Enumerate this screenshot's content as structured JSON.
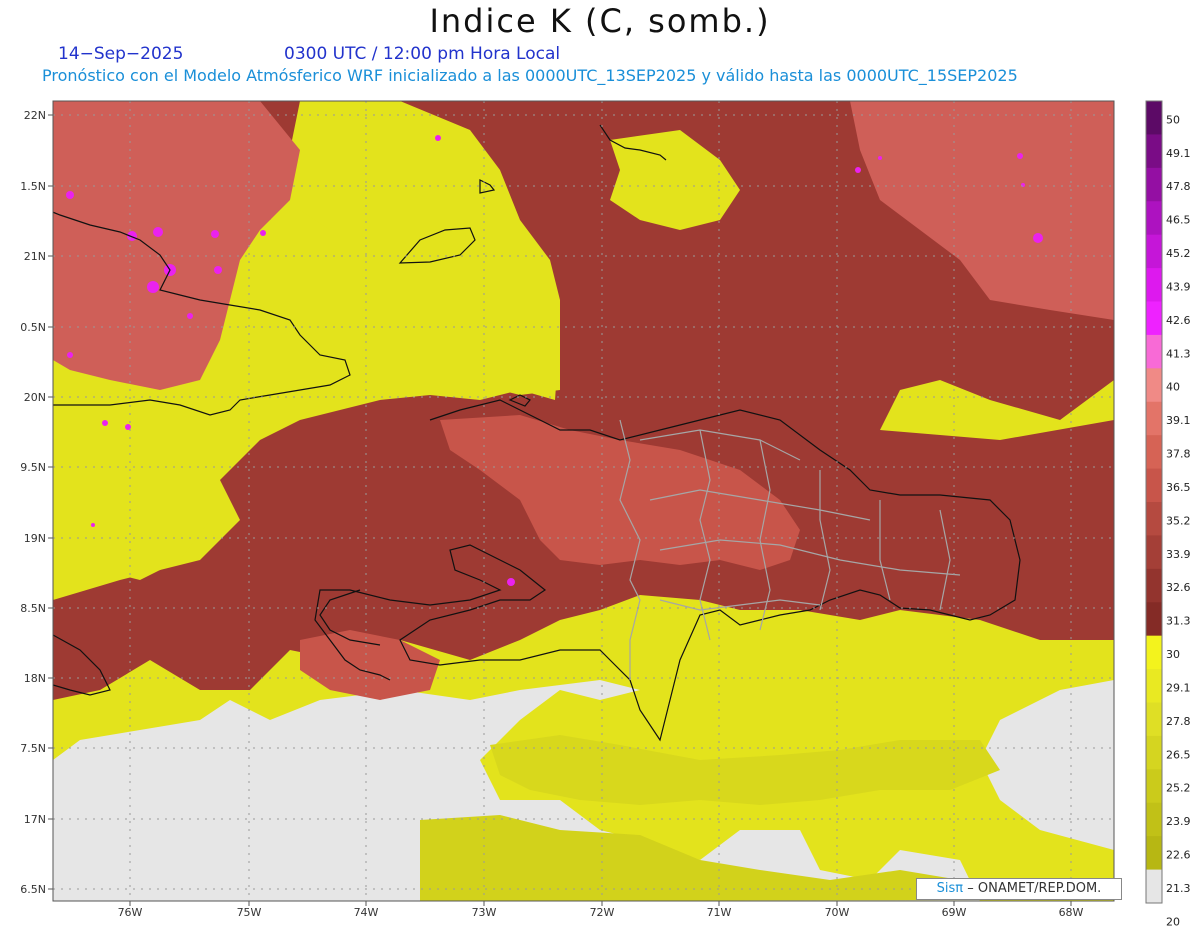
{
  "header": {
    "title": "Indice K (C, somb.)",
    "date": "14−Sep−2025",
    "time_line": "0300 UTC / 12:00 pm Hora Local",
    "model_line": "Pronóstico con el Modelo Atmósferico WRF inicializado a las 0000UTC_13SEP2025 y válido hasta las  0000UTC_15SEP2025"
  },
  "map": {
    "lat_labels": [
      "22N",
      "1.5N",
      "21N",
      "0.5N",
      "20N",
      "9.5N",
      "19N",
      "8.5N",
      "18N",
      "7.5N",
      "17N",
      "6.5N"
    ],
    "lon_labels": [
      "76W",
      "75W",
      "74W",
      "73W",
      "72W",
      "71W",
      "70W",
      "69W",
      "68W"
    ],
    "lat_range": [
      16.5,
      22.0
    ],
    "lon_range": [
      -76.6,
      -67.6
    ]
  },
  "colorbar": {
    "levels": [
      "50",
      "49.1",
      "47.8",
      "46.5",
      "45.2",
      "43.9",
      "42.6",
      "41.3",
      "40",
      "39.1",
      "37.8",
      "36.5",
      "35.2",
      "33.9",
      "32.6",
      "31.3",
      "30",
      "29.1",
      "27.8",
      "26.5",
      "25.2",
      "23.9",
      "22.6",
      "21.3",
      "20"
    ],
    "colors": [
      "#5c0a66",
      "#7a0c86",
      "#940fa3",
      "#ad12c0",
      "#c516d8",
      "#dd19ee",
      "#ee22ff",
      "#f86ad6",
      "#f08a86",
      "#e37468",
      "#d66355",
      "#c8554a",
      "#b54a40",
      "#a43f37",
      "#93342e",
      "#842b26",
      "#f3f31d",
      "#e9e922",
      "#dfdf25",
      "#d5d520",
      "#cbcb1b",
      "#c1c117",
      "#b7b713",
      "#e6e6e6"
    ],
    "band_colors": {
      "below20": "#e6e6e6",
      "range20_30": "#e3e31c",
      "range30_35": "#9e3a33",
      "range35_40": "#cf5f58",
      "above40": "#ea22ee"
    }
  },
  "credit": {
    "brand": "Sisπ",
    "text": "– ONAMET/REP.DOM."
  }
}
